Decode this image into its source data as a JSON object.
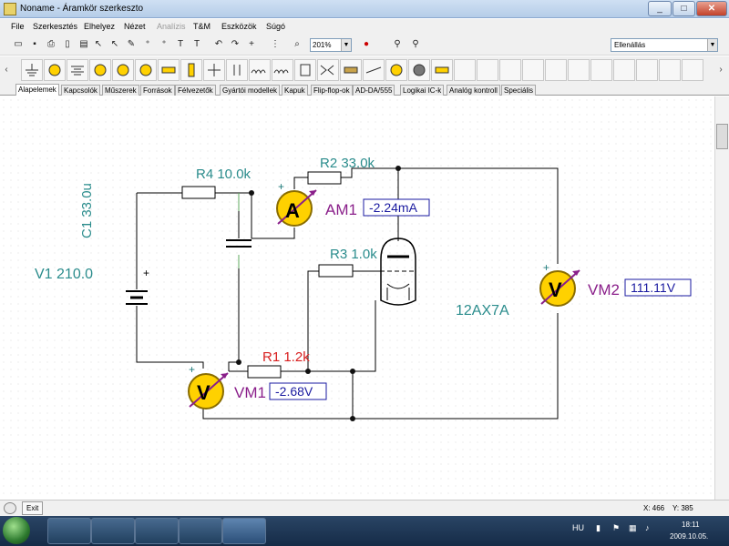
{
  "window": {
    "title": "Noname - Áramkör szerkeszto",
    "minimize": "_",
    "maximize": "□",
    "close": "✕"
  },
  "menu": {
    "items": [
      "File",
      "Szerkesztés",
      "Elhelyez",
      "Nézet",
      "Analízis",
      "T&M",
      "Eszközök",
      "Súgó"
    ]
  },
  "toolbar": {
    "zoom": "201%",
    "property_select": "Ellenállás"
  },
  "component_tabs": [
    "Alapelemek",
    "Kapcsolók",
    "Műszerek",
    "Források",
    "Félvezetők",
    "Gyártói modellek",
    "Kapuk",
    "Flip-flop-ok",
    "AD-DA/555",
    "Logikai IC-k",
    "Analóg kontroll",
    "Speciális"
  ],
  "circuit": {
    "r4": "R4 10.0k",
    "c1": "C1 33.0u",
    "v1": "V1 210.0",
    "r2": "R2 33.0k",
    "am1": "AM1",
    "am1_value": "-2.24mA",
    "am1_symbol": "A",
    "r3": "R3 1.0k",
    "tube": "12AX7A",
    "vm2": "VM2",
    "vm2_value": "111.11V",
    "vm2_symbol": "V",
    "r1": "R1 1.2k",
    "vm1": "VM1",
    "vm1_value": "-2.68V",
    "vm1_symbol": "V",
    "plus": "+"
  },
  "statusbar": {
    "exit_label": "Exit",
    "x_label": "X: 466",
    "y_label": "Y: 385"
  },
  "taskbar": {
    "language": "HU",
    "time": "18:11",
    "date": "2009.10.05."
  },
  "colors": {
    "label_teal": "#2a8c8c",
    "r1_red": "#d81e1e",
    "meter_purple": "#8a1f8a",
    "value_blue": "#1a1aa0",
    "meter_yellow": "#ffd100"
  }
}
